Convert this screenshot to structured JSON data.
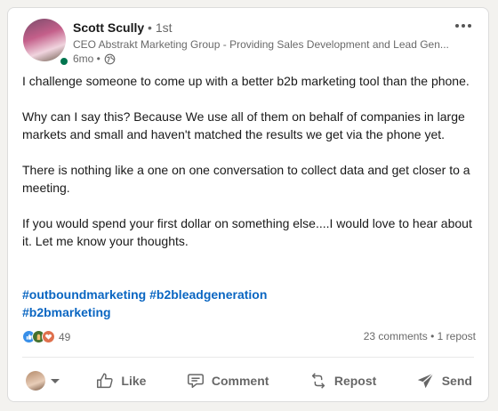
{
  "author": {
    "name": "Scott Scully",
    "degree": "• 1st",
    "headline": "CEO Abstrakt Marketing Group - Providing Sales Development and Lead Gen...",
    "age": "6mo •"
  },
  "post": {
    "paragraphs": [
      "I challenge someone to come up with a better b2b marketing tool than the phone.",
      "Why can I say this? Because We use all of them on behalf of companies in large markets and small and haven't matched the results we get via the phone yet.",
      "There is nothing like a one on one conversation to collect data and get closer to a meeting.",
      "If you would spend your first dollar on something else....I would love to hear about it. Let me know your thoughts."
    ],
    "hashtags": [
      "#outboundmarketing",
      "#b2bleadgeneration",
      "#b2bmarketing"
    ]
  },
  "social": {
    "reaction_count": "49",
    "comments": "23 comments",
    "separator": "•",
    "reposts": "1 repost"
  },
  "actions": {
    "like": "Like",
    "comment": "Comment",
    "repost": "Repost",
    "send": "Send"
  },
  "colors": {
    "link": "#0a66c2",
    "online": "#01754f",
    "like_reaction": "#378fe9",
    "celebrate_reaction": "#44712e",
    "love_reaction": "#df704d"
  }
}
